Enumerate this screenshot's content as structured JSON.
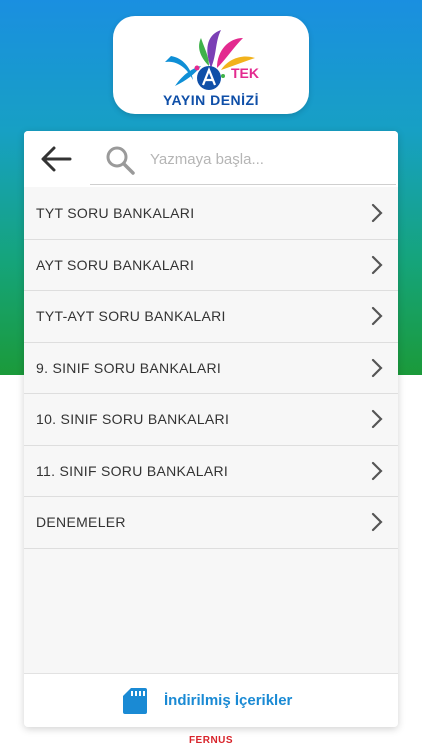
{
  "logo": {
    "title": "YAYIN DENİZİ",
    "badge": "TEK"
  },
  "search": {
    "placeholder": "Yazmaya başla..."
  },
  "menu": {
    "items": [
      {
        "label": "TYT SORU BANKALARI"
      },
      {
        "label": "AYT SORU BANKALARI"
      },
      {
        "label": "TYT-AYT SORU BANKALARI"
      },
      {
        "label": "9. SINIF SORU BANKALARI"
      },
      {
        "label": "10. SINIF SORU BANKALARI"
      },
      {
        "label": "11. SINIF SORU BANKALARI"
      },
      {
        "label": "DENEMELER"
      }
    ]
  },
  "footer": {
    "label": "İndirilmiş İçerikler",
    "icon": "sd-card-icon"
  },
  "brand": {
    "label": "FERNUS"
  },
  "colors": {
    "accent": "#1a8ad4",
    "logo_blue": "#0f4fa8",
    "logo_pink": "#e32a8f",
    "brand_red": "#d8232a"
  }
}
